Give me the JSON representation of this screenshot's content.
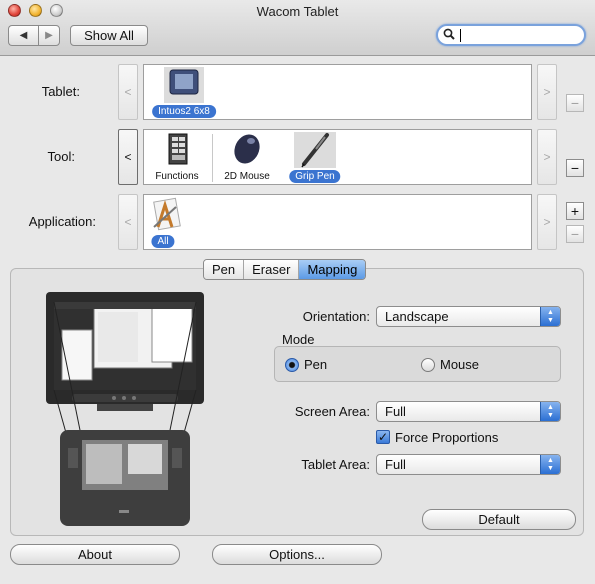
{
  "window": {
    "title": "Wacom Tablet"
  },
  "toolbar": {
    "back_label": "◀",
    "forward_label": "▶",
    "show_all_label": "Show All",
    "search_placeholder": ""
  },
  "rows": {
    "tablet": {
      "label": "Tablet:",
      "items": [
        {
          "label": "Intuos2 6x8",
          "icon": "tablet-icon",
          "selected": true
        }
      ]
    },
    "tool": {
      "label": "Tool:",
      "items": [
        {
          "label": "Functions",
          "icon": "functions-icon",
          "selected": false
        },
        {
          "label": "2D Mouse",
          "icon": "mouse-icon",
          "selected": false
        },
        {
          "label": "Grip Pen",
          "icon": "pen-icon",
          "selected": true
        }
      ]
    },
    "application": {
      "label": "Application:",
      "items": [
        {
          "label": "All",
          "icon": "all-applications-icon",
          "selected": true
        }
      ]
    }
  },
  "arrows": {
    "left": "<",
    "right": ">"
  },
  "side_buttons": {
    "minus": "−",
    "plus": "+"
  },
  "tabs": [
    {
      "label": "Pen",
      "active": false
    },
    {
      "label": "Eraser",
      "active": false
    },
    {
      "label": "Mapping",
      "active": true
    }
  ],
  "mapping": {
    "orientation": {
      "label": "Orientation:",
      "value": "Landscape"
    },
    "mode": {
      "label": "Mode",
      "options": [
        {
          "label": "Pen",
          "selected": true
        },
        {
          "label": "Mouse",
          "selected": false
        }
      ]
    },
    "screen_area": {
      "label": "Screen Area:",
      "value": "Full"
    },
    "force_proportions": {
      "label": "Force Proportions",
      "checked": true
    },
    "tablet_area": {
      "label": "Tablet Area:",
      "value": "Full"
    },
    "default_label": "Default"
  },
  "footer": {
    "about_label": "About",
    "options_label": "Options..."
  },
  "colors": {
    "selection": "#3b74d0",
    "accent": "#5c9ae6"
  }
}
